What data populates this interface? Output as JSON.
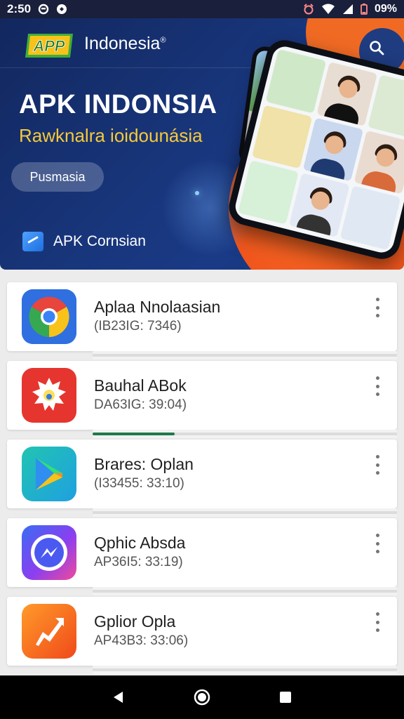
{
  "status_bar": {
    "time": "2:50",
    "battery": "09%",
    "icons": [
      "message-icon",
      "data-saver-icon",
      "alarm-icon",
      "wifi-icon",
      "signal-icon",
      "battery-icon"
    ]
  },
  "header": {
    "logo_text": "APP",
    "title": "Indonesia",
    "title_mark": "®",
    "search_icon": "search-icon"
  },
  "hero": {
    "headline": "APK INDONSIA",
    "subheadline": "Rawknalra ioidounásia",
    "pill_label": "Pusmasia",
    "footer_label": "APK Cornsian",
    "colors": {
      "background": "#18357a",
      "accent_orange": "#f0531c",
      "subtitle": "#f5c93a"
    }
  },
  "apps": [
    {
      "name": "Aplaa Nnolaasian",
      "meta": "(IB23IG: 7346)",
      "icon": "chrome-icon",
      "progress": 0
    },
    {
      "name": "Bauhal ABok",
      "meta": "DA63IG: 39:04)",
      "icon": "spiky-bug-icon",
      "progress": 0.27
    },
    {
      "name": "Brares: Oplan",
      "meta": "(I33455: 33:10)",
      "icon": "play-store-icon",
      "progress": 0
    },
    {
      "name": "Qphic Absda",
      "meta": "AP36I5: 33:19)",
      "icon": "messenger-icon",
      "progress": 0
    },
    {
      "name": "Gplior Opla",
      "meta": "AP43B3: 33:06)",
      "icon": "shortcut-arrow-icon",
      "progress": 0
    }
  ],
  "nav": {
    "back_icon": "back-icon",
    "home_icon": "home-icon",
    "recents_icon": "recents-icon"
  }
}
